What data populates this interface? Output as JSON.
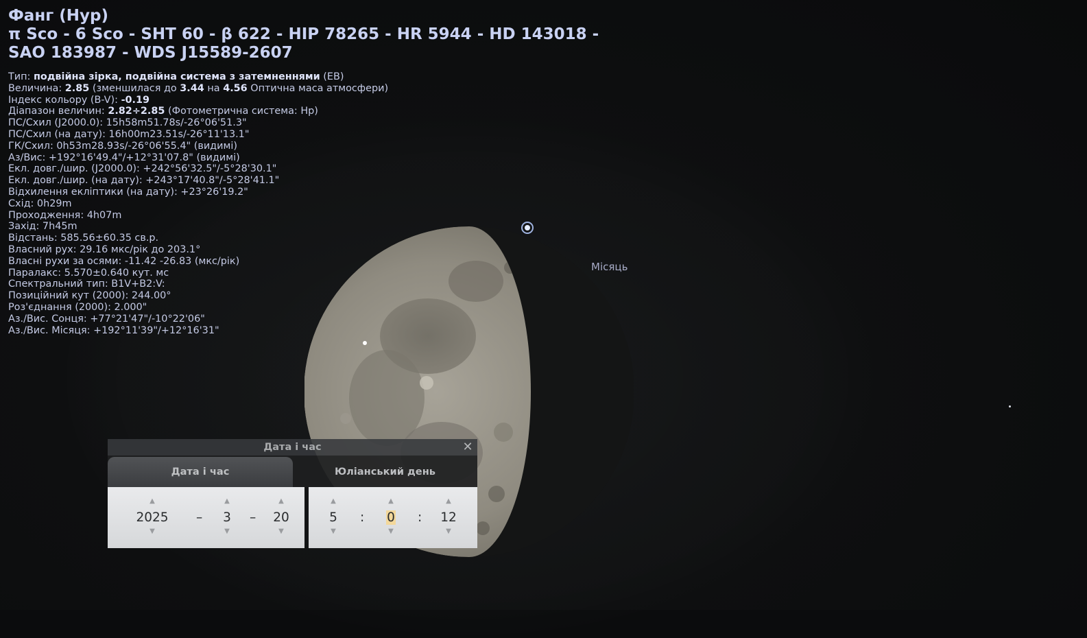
{
  "object": {
    "title": "Фанг (Нур)",
    "designations": "π Sco - 6 Sco - SHT 60 - β 622 - HIP 78265 - HR 5944 - HD 143018 - SAO 183987 - WDS J15589-2607"
  },
  "info_lines": {
    "type_label": "Тип: ",
    "type_value": "подвійна зірка, подвійна система з затемненнями",
    "type_suffix": " (EB)",
    "mag_label": "Величина: ",
    "mag_value": "2.85",
    "mag_mid1": " (зменшилася до ",
    "mag_reduced": "3.44",
    "mag_mid2": " на ",
    "mag_airmass": "4.56",
    "mag_suffix": " Оптична маса атмосфери)",
    "color_label": "Індекс кольору (B-V): ",
    "color_value": "-0.19",
    "range_label": "Діапазон величин: ",
    "range_value": "2.82÷2.85",
    "range_suffix": " (Фотометрична система: Hp)",
    "radec_j2000": "ПС/Схил (J2000.0): 15h58m51.78s/-26°06'51.3\"",
    "radec_date": "ПС/Схил (на дату): 16h00m23.51s/-26°11'13.1\"",
    "hadec": "ГК/Схил: 0h53m28.93s/-26°06'55.4\" (видимі)",
    "azalt": "Аз/Вис: +192°16'49.4\"/+12°31'07.8\" (видимі)",
    "ecl_j2000": "Екл. довг./шир. (J2000.0): +242°56'32.5\"/-5°28'30.1\"",
    "ecl_date": "Екл. довг./шир. (на дату): +243°17'40.8\"/-5°28'41.1\"",
    "obliquity": "Відхилення екліптики (на дату): +23°26'19.2\"",
    "rise": "Схід: 0h29m",
    "transit": "Проходження: 4h07m",
    "set": "Захід: 7h45m",
    "distance": "Відстань: 585.56±60.35 св.р.",
    "pm": "Власний рух: 29.16 мкс/рік до 203.1°",
    "pm_axes": "Власні рухи за осями: -11.42 -26.83 (мкс/рік)",
    "parallax": "Паралакс: 5.570±0.640 кут. мс",
    "spectral": "Спектральний тип: B1V+B2:V:",
    "pa": "Позиційний кут (2000): 244.00°",
    "sep": "Роз'єднання (2000): 2.000\"",
    "sun_azalt": "Аз./Вис. Сонця: +77°21'47\"/-10°22'06\"",
    "moon_azalt": "Аз./Вис. Місяця: +192°11'39\"/+12°16'31\""
  },
  "moon_label": "Місяць",
  "dialog": {
    "title": "Дата і час",
    "close_glyph": "✕",
    "tabs": [
      "Дата і час",
      "Юліанський день"
    ],
    "date": {
      "year": "2025",
      "month": "3",
      "day": "20",
      "separator": "–"
    },
    "time": {
      "hour": "5",
      "minute": "0",
      "second": "12",
      "separator": ":"
    },
    "arrow_up": "▲",
    "arrow_down": "▼"
  },
  "colors": {
    "info_text": "#c5cbe6",
    "highlight": "#f3d89b",
    "sky": "#0b0c0d"
  }
}
